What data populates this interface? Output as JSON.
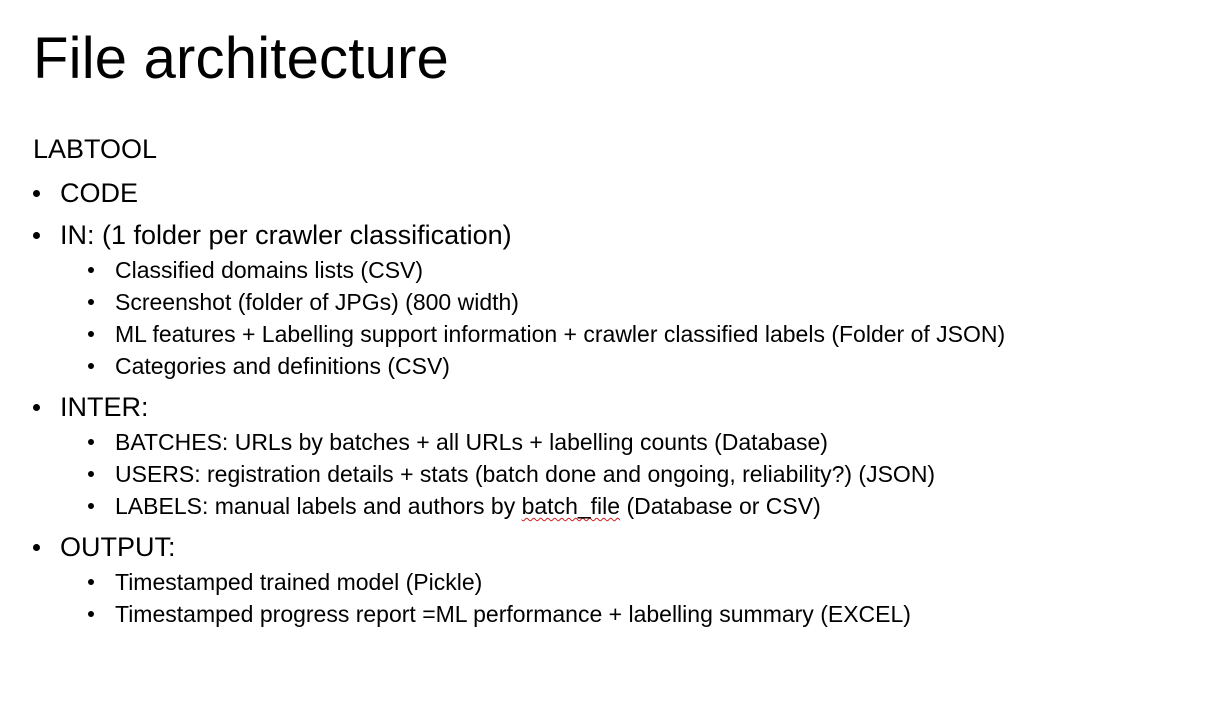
{
  "slide": {
    "title": "File architecture",
    "root_label": "LABTOOL",
    "sections": [
      {
        "label": "CODE",
        "items": []
      },
      {
        "label": "IN: (1 folder per crawler classification)",
        "items": [
          "Classified domains lists (CSV)",
          "Screenshot (folder of JPGs) (800 width)",
          "ML features + Labelling support information + crawler classified labels (Folder of JSON)",
          "Categories and definitions (CSV)"
        ]
      },
      {
        "label": "INTER:",
        "items": [
          "BATCHES: URLs by batches + all URLs + labelling counts (Database)",
          "USERS: registration details + stats (batch done and ongoing, reliability?) (JSON)",
          "LABELS: manual labels and authors by batch_file (Database or CSV)"
        ]
      },
      {
        "label": "OUTPUT:",
        "items": [
          "Timestamped trained model (Pickle)",
          "Timestamped progress report =ML performance +  labelling  summary (EXCEL)"
        ]
      }
    ],
    "labels_item_parts": {
      "before": "LABELS: manual labels and authors by ",
      "misspelled": "batch_file",
      "after": " (Database or CSV)"
    }
  },
  "colors": {
    "background": "#ffffff",
    "text": "#000000",
    "spellcheck_underline": "#d11a1a"
  }
}
